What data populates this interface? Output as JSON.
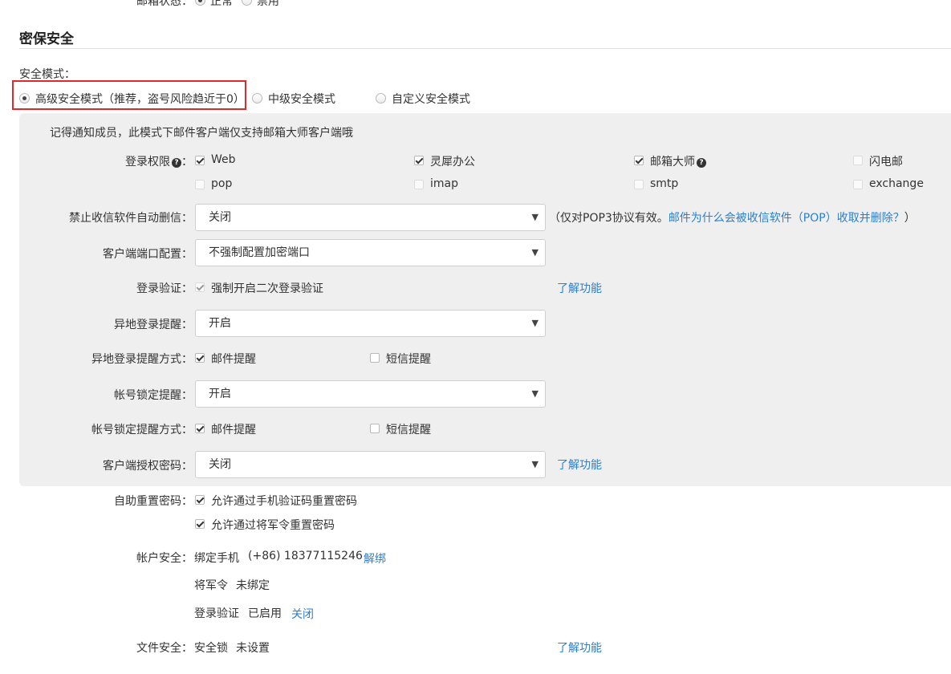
{
  "top_status": {
    "label": "邮箱状态：",
    "options": [
      "正常",
      "禁用"
    ]
  },
  "section_title": "密保安全",
  "security_mode": {
    "label": "安全模式：",
    "options": [
      "高级安全模式（推荐，盗号风险趋近于0）",
      "中级安全模式",
      "自定义安全模式"
    ]
  },
  "notice": "记得通知成员，此模式下邮件客户端仅支持邮箱大师客户端哦",
  "login_permission": {
    "label": "登录权限",
    "help": "?",
    "colon": "：",
    "row1": [
      "Web",
      "灵犀办公",
      "邮箱大师",
      "闪电邮"
    ],
    "mail_master_help": "?",
    "row2": [
      "pop",
      "imap",
      "smtp",
      "exchange"
    ]
  },
  "auto_delete": {
    "label": "禁止收信软件自动删信：",
    "value": "关闭",
    "note_prefix": "（仅对POP3协议有效。",
    "note_link": "邮件为什么会被收信软件（POP）收取并删除？",
    "note_suffix": "）"
  },
  "client_port": {
    "label": "客户端端口配置：",
    "value": "不强制配置加密端口"
  },
  "login_verify": {
    "label": "登录验证：",
    "option": "强制开启二次登录验证",
    "link": "了解功能"
  },
  "remote_login_alert": {
    "label": "异地登录提醒：",
    "value": "开启"
  },
  "remote_login_method": {
    "label": "异地登录提醒方式：",
    "options": [
      "邮件提醒",
      "短信提醒"
    ]
  },
  "lock_alert": {
    "label": "帐号锁定提醒：",
    "value": "开启"
  },
  "lock_alert_method": {
    "label": "帐号锁定提醒方式：",
    "options": [
      "邮件提醒",
      "短信提醒"
    ]
  },
  "client_auth_password": {
    "label": "客户端授权密码：",
    "value": "关闭",
    "link": "了解功能"
  },
  "self_reset": {
    "label": "自助重置密码：",
    "options": [
      "允许通过手机验证码重置密码",
      "允许通过将军令重置密码"
    ]
  },
  "account_security": {
    "label": "帐户安全：",
    "phone_label": "绑定手机",
    "phone_value": "(+86) 18377115246",
    "unbind_link": "解绑",
    "token_label": "将军令",
    "token_value": "未绑定",
    "verify_label": "登录验证",
    "verify_value": "已启用",
    "verify_link": "关闭"
  },
  "file_security": {
    "label": "文件安全：",
    "lock_label": "安全锁",
    "lock_value": "未设置",
    "link": "了解功能"
  },
  "colors": {
    "link": "#2a7fcf",
    "highlight": "#e02a2a",
    "panel": "#efefef"
  }
}
